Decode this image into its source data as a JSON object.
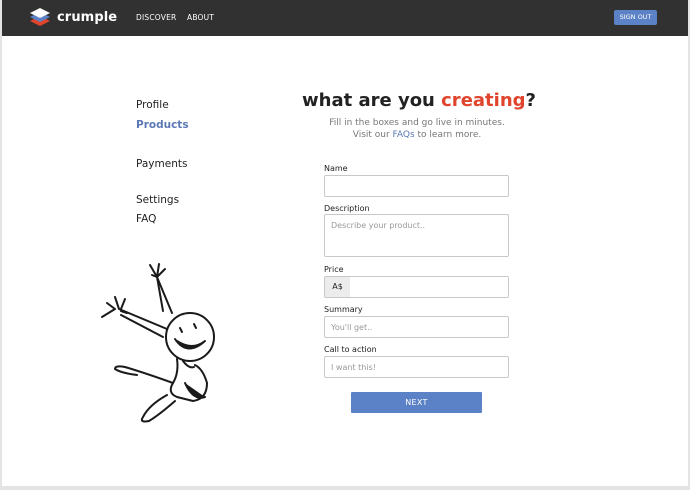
{
  "brand": {
    "name": "crumple",
    "logo_icon": "stacked-layers-icon",
    "logo_colors": [
      "#e0442c",
      "#5b82c6",
      "#ffffff"
    ]
  },
  "nav": {
    "discover": "DISCOVER",
    "about": "ABOUT",
    "sign_out": "SIGN OUT"
  },
  "sidebar": {
    "items": [
      {
        "label": "Profile",
        "active": false
      },
      {
        "label": "Products",
        "active": true
      },
      {
        "label": "Payments",
        "active": false
      },
      {
        "label": "Settings",
        "active": false
      },
      {
        "label": "FAQ",
        "active": false
      }
    ]
  },
  "hero": {
    "title_prefix": "what are you ",
    "title_accent": "creating",
    "title_suffix": "?",
    "subtitle_line1": "Fill in the boxes and go live in minutes.",
    "subtitle_line2_prefix": "Visit our ",
    "subtitle_link": "FAQs",
    "subtitle_line2_suffix": " to learn more."
  },
  "form": {
    "name": {
      "label": "Name",
      "value": "",
      "placeholder": ""
    },
    "description": {
      "label": "Description",
      "value": "",
      "placeholder": "Describe your product.."
    },
    "price": {
      "label": "Price",
      "prefix": "A$",
      "value": "",
      "placeholder": ""
    },
    "summary": {
      "label": "Summary",
      "value": "",
      "placeholder": "You'll get.."
    },
    "cta": {
      "label": "Call to action",
      "value": "",
      "placeholder": "I want this!"
    },
    "next_label": "NEXT"
  },
  "illustration": {
    "icon": "jumping-stick-figure-icon"
  },
  "colors": {
    "topbar": "#313131",
    "accent_blue": "#5b82c6",
    "accent_red": "#e0442c",
    "active_link": "#5b78b4"
  }
}
